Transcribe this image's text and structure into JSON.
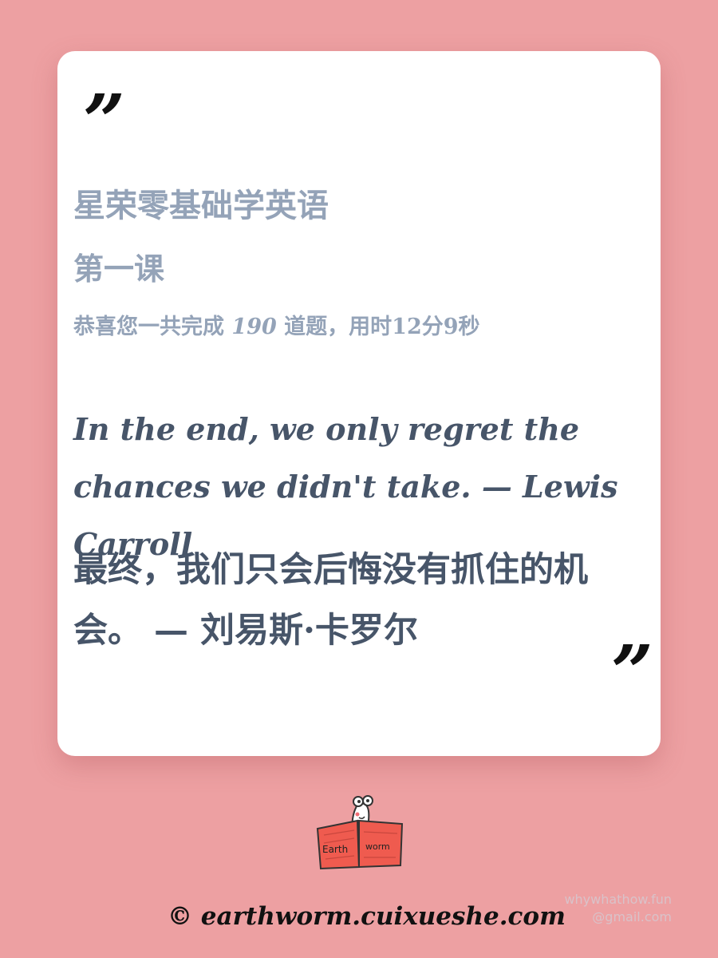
{
  "card": {
    "open_quote": "”",
    "close_quote": "”",
    "course_title": "星荣零基础学英语",
    "lesson": "第一课",
    "stats": {
      "prefix": "恭喜您一共完成 ",
      "count": "190",
      "suffix": " 道题，用时12分9秒"
    },
    "quote_en": "In the end, we only regret the chances we didn't take. — Lewis Carroll",
    "quote_zh": "最终，我们只会后悔没有抓住的机会。 — 刘易斯·卡罗尔"
  },
  "logo": {
    "icon": "earthworm-book-logo-icon",
    "text_left": "Earth",
    "text_right": "worm"
  },
  "watermark": {
    "line1": "whywhathow.fun",
    "line2": "@gmail.com"
  },
  "footer": {
    "copyright": "© earthworm.cuixueshe.com"
  },
  "colors": {
    "background": "#eda0a2",
    "card": "#ffffff",
    "muted_text": "#94a3b8",
    "quote_text": "#475569"
  }
}
